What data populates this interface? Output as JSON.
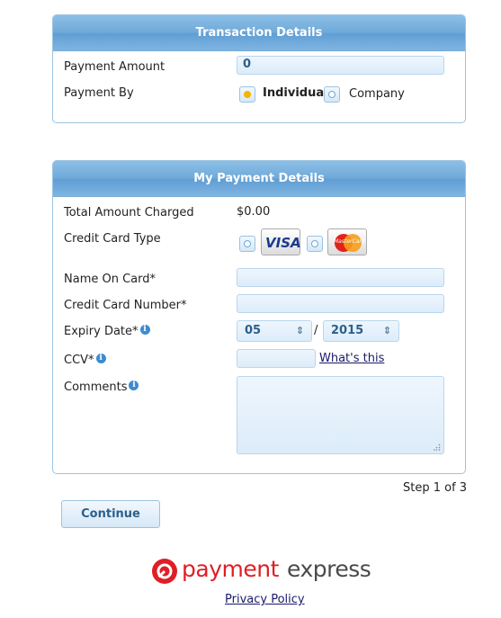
{
  "transaction": {
    "title": "Transaction Details",
    "amount_label": "Payment Amount",
    "amount_value": "0",
    "payment_by_label": "Payment By",
    "option_individual": "Individual",
    "option_company": "Company"
  },
  "payment": {
    "title": "My Payment Details",
    "total_label": "Total Amount Charged",
    "total_value": "$0.00",
    "card_type_label": "Credit Card Type",
    "visa_label": "VISA",
    "mastercard_label": "MasterCard",
    "name_label": "Name On Card*",
    "number_label": "Credit Card Number*",
    "expiry_label": "Expiry Date*",
    "expiry_month": "05",
    "expiry_separator": "/",
    "expiry_year": "2015",
    "ccv_label": "CCV*",
    "whats_this": "What's this",
    "comments_label": "Comments"
  },
  "step_text": "Step 1 of 3",
  "continue_label": "Continue",
  "brand": {
    "name_left": "payment",
    "name_right": "express",
    "accent_color": "#e01e25",
    "text_color": "#4a4a4a"
  },
  "privacy_link": "Privacy Policy"
}
